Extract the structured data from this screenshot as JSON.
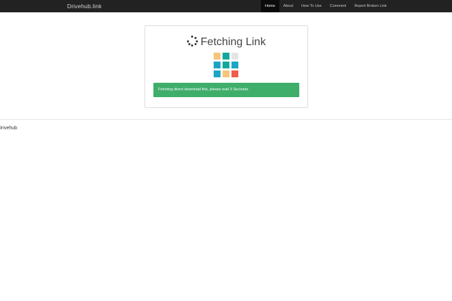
{
  "navbar": {
    "brand": "Drivehub.link",
    "items": [
      {
        "label": "Home",
        "active": true
      },
      {
        "label": "About",
        "active": false
      },
      {
        "label": "How To Use",
        "active": false
      },
      {
        "label": "Comment",
        "active": false
      },
      {
        "label": "Report Broken Link",
        "active": false
      }
    ]
  },
  "card": {
    "heading": "Fetching Link",
    "spinner_icon": "loading-spinner-icon",
    "loader_icon": "tile-loader-icon",
    "loader_colors": [
      "#f5c57a",
      "#12a89d",
      "#e5e5e5",
      "#1aa5c5",
      "#12a89d",
      "#1aa5c5",
      "#1aa5c5",
      "#f5c57a",
      "#ef5b4c"
    ],
    "alert_text": "Fetching direct download link, please wait 3 Seconds.",
    "alert_color": "#3fae6b"
  },
  "footer": {
    "text": "Drivehub"
  }
}
